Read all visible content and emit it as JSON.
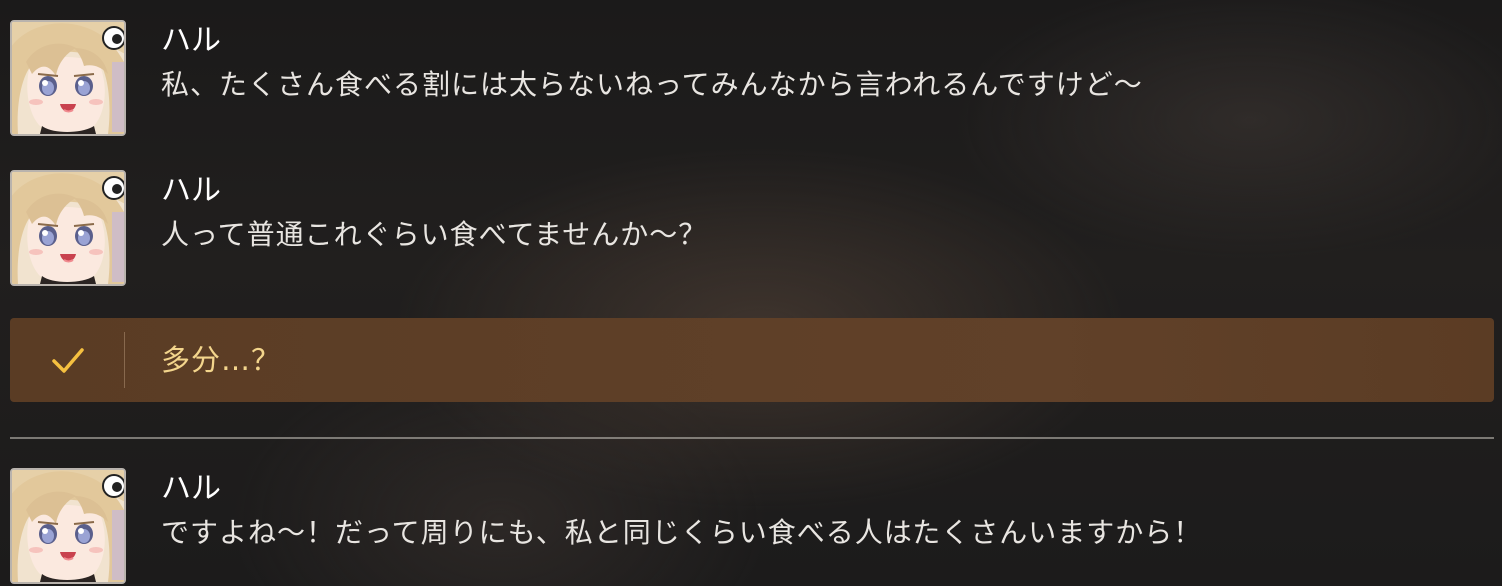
{
  "log": {
    "entries": [
      {
        "speaker": "ハル",
        "text": "私、たくさん食べる割には太らないねってみんなから言われるんですけど〜",
        "avatar_icon": "haru-portrait-icon"
      },
      {
        "speaker": "ハル",
        "text": "人って普通これぐらい食べてませんか〜？",
        "avatar_icon": "haru-portrait-icon"
      },
      {
        "speaker": "ハル",
        "text": "ですよね〜！だって周りにも、私と同じくらい食べる人はたくさんいますから！",
        "avatar_icon": "haru-portrait-icon"
      }
    ],
    "selected_choice": {
      "text": "多分…？",
      "icon": "checkmark-icon"
    }
  },
  "colors": {
    "choice_highlight": "#5e3f27",
    "choice_text": "#f3d58c",
    "check_accent": "#f5c040",
    "speaker_text": "#ffffff",
    "line_text": "#e8e5e1"
  }
}
